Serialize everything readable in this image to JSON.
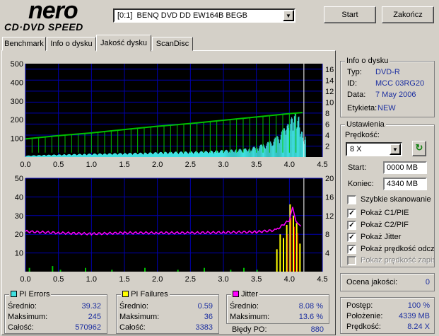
{
  "logo": {
    "brand": "nero",
    "product": "CD·DVD SPEED"
  },
  "toolbar": {
    "drive": "[0:1]  BENQ DVD DD EW164B BEGB",
    "start_label": "Start",
    "exit_label": "Zakończ"
  },
  "tabs": [
    "Benchmark",
    "Info o dysku",
    "Jakość dysku",
    "ScanDisc"
  ],
  "active_tab": 2,
  "disc_info": {
    "title": "Info o dysku",
    "type_label": "Typ:",
    "type": "DVD-R",
    "id_label": "ID:",
    "id": "MCC 03RG20",
    "date_label": "Data:",
    "date": "7 May 2006",
    "tag_label": "Etykieta:",
    "tag": "NEW"
  },
  "settings": {
    "title": "Ustawienia",
    "speed_label": "Prędkość:",
    "speed": "8 X",
    "start_label": "Start:",
    "start": "0000 MB",
    "end_label": "Koniec:",
    "end": "4340 MB",
    "quick_scan": "Szybkie skanowanie",
    "show_c1": "Pokaż C1/PIE",
    "show_c2": "Pokaż C2/PIF",
    "show_jitter": "Pokaż Jitter",
    "show_read": "Pokaż prędkość odczytu",
    "show_write": "Pokaż prędkość zapisu",
    "checked": [
      false,
      true,
      true,
      true,
      true,
      false
    ]
  },
  "quality": {
    "label": "Ocena jakości:",
    "value": "0"
  },
  "progress": {
    "progress_label": "Postęp:",
    "progress": "100 %",
    "position_label": "Położenie:",
    "position": "4339 MB",
    "speed_label": "Prędkość:",
    "speed": "8.24 X"
  },
  "pi_errors": {
    "title": "PI Errors",
    "color": "#40e0e0",
    "avg_label": "Średnio:",
    "avg": "39.32",
    "max_label": "Maksimum:",
    "max": "245",
    "total_label": "Całość:",
    "total": "570962"
  },
  "pi_failures": {
    "title": "PI Failures",
    "color": "#ffff00",
    "avg_label": "Średnio:",
    "avg": "0.59",
    "max_label": "Maksimum:",
    "max": "36",
    "total_label": "Całość:",
    "total": "3383"
  },
  "jitter": {
    "title": "Jitter",
    "color": "#ff00ff",
    "avg_label": "Średnio:",
    "avg": "8.08 %",
    "max_label": "Maksimum:",
    "max": "13.6 %",
    "po_label": "Błędy PO:",
    "po": "880"
  },
  "chart_data": [
    {
      "type": "area",
      "x_ticks": [
        "0.0",
        "0.5",
        "1.0",
        "1.5",
        "2.0",
        "2.5",
        "3.0",
        "3.5",
        "4.0",
        "4.5"
      ],
      "xlim": [
        0,
        4.5
      ],
      "y_left_ticks": [
        "100",
        "200",
        "300",
        "400",
        "500"
      ],
      "ylim_left": [
        0,
        500
      ],
      "y_right_ticks": [
        "2",
        "4",
        "6",
        "8",
        "10",
        "12",
        "14",
        "16"
      ],
      "ylim_right": [
        0,
        17
      ],
      "series": [
        {
          "values_x": [
            0,
            0.3,
            0.6,
            0.9,
            1.2,
            1.5,
            1.8,
            2.1,
            2.4,
            2.7,
            3.0,
            3.2,
            3.4,
            3.5,
            3.6,
            3.7,
            3.8,
            3.9,
            3.95,
            4.0,
            4.05,
            4.1,
            4.15,
            4.2
          ],
          "values_y": [
            8,
            12,
            15,
            18,
            20,
            22,
            24,
            28,
            30,
            32,
            38,
            42,
            50,
            60,
            72,
            85,
            110,
            150,
            170,
            190,
            230,
            245,
            210,
            120
          ]
        },
        {
          "values_x": [
            0,
            0.5,
            1.0,
            1.5,
            2.0,
            2.5,
            3.0,
            3.5,
            4.0,
            4.2
          ],
          "values_y": [
            3.3,
            3.9,
            4.4,
            5.0,
            5.6,
            6.1,
            6.7,
            7.3,
            7.9,
            8.1
          ]
        }
      ]
    },
    {
      "type": "bar",
      "x_ticks": [
        "0.0",
        "0.5",
        "1.0",
        "1.5",
        "2.0",
        "2.5",
        "3.0",
        "3.5",
        "4.0",
        "4.5"
      ],
      "xlim": [
        0,
        4.5
      ],
      "y_left_ticks": [
        "10",
        "20",
        "30",
        "40",
        "50"
      ],
      "ylim_left": [
        0,
        50
      ],
      "y_right_ticks": [
        "4",
        "8",
        "12",
        "16",
        "20"
      ],
      "ylim_right": [
        0,
        20
      ],
      "series": [
        {
          "values_x": [
            0.05,
            0.4,
            0.52,
            0.9,
            1.3,
            1.8,
            2.3,
            2.7,
            3.1,
            3.3,
            3.5,
            3.8,
            3.85,
            3.9,
            3.95,
            4.0,
            4.05,
            4.1,
            4.15
          ],
          "values_y": [
            2,
            3,
            1,
            2,
            1,
            2,
            1,
            2,
            1,
            2,
            1,
            12,
            20,
            18,
            25,
            36,
            30,
            26,
            15
          ]
        },
        {
          "values_x": [
            0,
            0.5,
            1.0,
            1.5,
            2.0,
            2.5,
            3.0,
            3.5,
            3.8,
            3.9,
            4.0,
            4.05,
            4.1,
            4.15,
            4.2
          ],
          "values_y": [
            8.6,
            8.3,
            8.1,
            8.3,
            8.3,
            8.3,
            8.4,
            8.5,
            8.9,
            10,
            11,
            13.6,
            11,
            10,
            9
          ]
        }
      ]
    }
  ]
}
